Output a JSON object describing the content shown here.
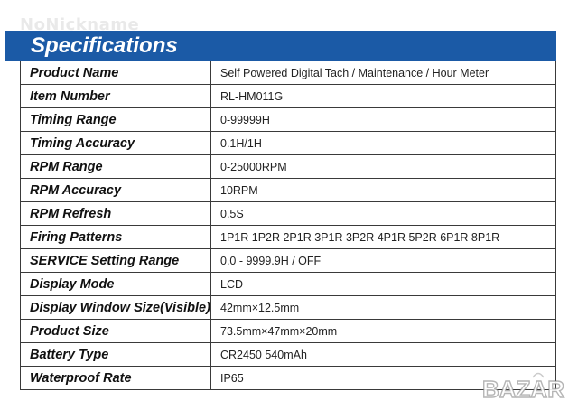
{
  "watermark_text": "NoNickname",
  "header": {
    "title": "Specifications",
    "color": "#1b5aa6"
  },
  "specs": [
    {
      "label": "Product Name",
      "value": "Self Powered Digital Tach / Maintenance / Hour Meter"
    },
    {
      "label": "Item Number",
      "value": "RL-HM011G"
    },
    {
      "label": "Timing Range",
      "value": "0-99999H"
    },
    {
      "label": "Timing Accuracy",
      "value": "0.1H/1H"
    },
    {
      "label": "RPM Range",
      "value": "0-25000RPM"
    },
    {
      "label": "RPM Accuracy",
      "value": "10RPM"
    },
    {
      "label": "RPM Refresh",
      "value": "0.5S"
    },
    {
      "label": "Firing Patterns",
      "value": "1P1R 1P2R 2P1R 3P1R 3P2R 4P1R 5P2R 6P1R 8P1R"
    },
    {
      "label": "SERVICE Setting Range",
      "value": "0.0 - 9999.9H / OFF"
    },
    {
      "label": "Display Mode",
      "value": "LCD"
    },
    {
      "label": "Display Window Size(Visible)",
      "value": "42mm×12.5mm"
    },
    {
      "label": "Product Size",
      "value": "73.5mm×47mm×20mm"
    },
    {
      "label": "Battery Type",
      "value": "CR2450 540mAh"
    },
    {
      "label": "Waterproof Rate",
      "value": "IP65"
    }
  ],
  "watermark_logo": "BAZAR"
}
